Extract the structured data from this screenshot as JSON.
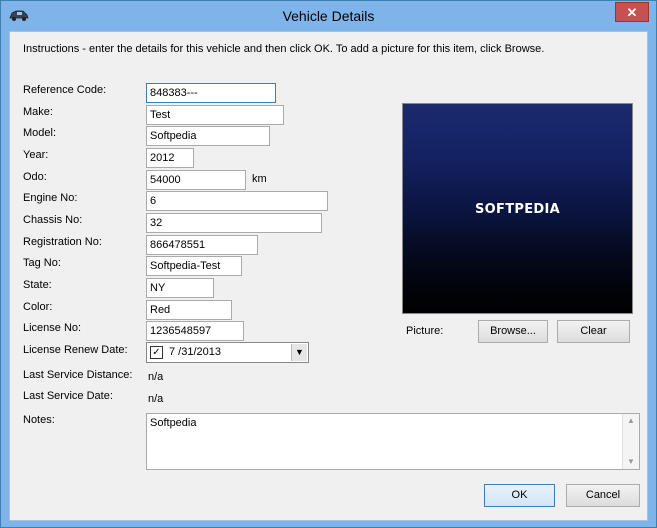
{
  "window": {
    "title": "Vehicle Details",
    "close_glyph": "✕"
  },
  "instructions": "Instructions - enter the details for this vehicle and then click OK. To add a picture for this item, click Browse.",
  "labels": {
    "reference_code": "Reference Code:",
    "make": "Make:",
    "model": "Model:",
    "year": "Year:",
    "odo": "Odo:",
    "engine_no": "Engine No:",
    "chassis_no": "Chassis No:",
    "registration_no": "Registration No:",
    "tag_no": "Tag No:",
    "state": "State:",
    "color": "Color:",
    "license_no": "License No:",
    "license_renew_date": "License Renew Date:",
    "last_service_distance": "Last Service Distance:",
    "last_service_date": "Last Service Date:",
    "notes": "Notes:",
    "picture": "Picture:"
  },
  "values": {
    "reference_code": "848383---",
    "make": "Test",
    "model": "Softpedia",
    "year": "2012",
    "odo": "54000",
    "odo_unit": "km",
    "engine_no": "6",
    "chassis_no": "32",
    "registration_no": "866478551",
    "tag_no": "Softpedia-Test",
    "state": "NY",
    "color": "Red",
    "license_no": "1236548597",
    "license_renew_date": "7 /31/2013",
    "license_renew_checked": "✓",
    "last_service_distance": "n/a",
    "last_service_date": "n/a",
    "notes": "Softpedia"
  },
  "picture": {
    "caption": "SOFTPEDIA"
  },
  "buttons": {
    "browse": "Browse...",
    "clear": "Clear",
    "ok": "OK",
    "cancel": "Cancel"
  },
  "icons": {
    "dropdown": "▼",
    "scroll_up": "▲",
    "scroll_down": "▼"
  },
  "colors": {
    "titlebar": "#7eb4ea",
    "close": "#c75050",
    "dialog_bg": "#f0f0f0"
  }
}
